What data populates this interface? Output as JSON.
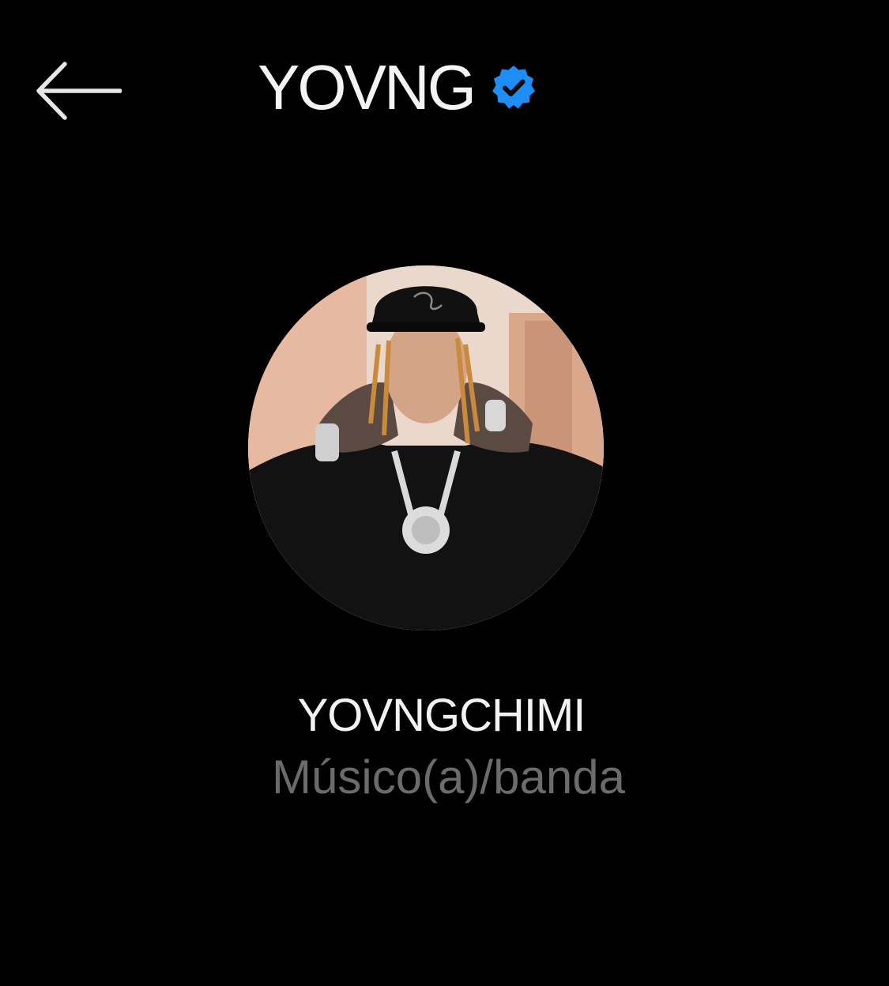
{
  "header": {
    "back_icon": "arrow-left-icon",
    "title": "YOVNG",
    "verified_icon": "verified-badge-icon",
    "verified_color": "#1d8ef5"
  },
  "profile": {
    "avatar_icon": "profile-photo",
    "name": "YOVNGCHIMI",
    "category": "Músico(a)/banda"
  },
  "colors": {
    "background": "#000000",
    "primary_text": "#f2f2f2",
    "secondary_text": "#6b6b6b"
  }
}
